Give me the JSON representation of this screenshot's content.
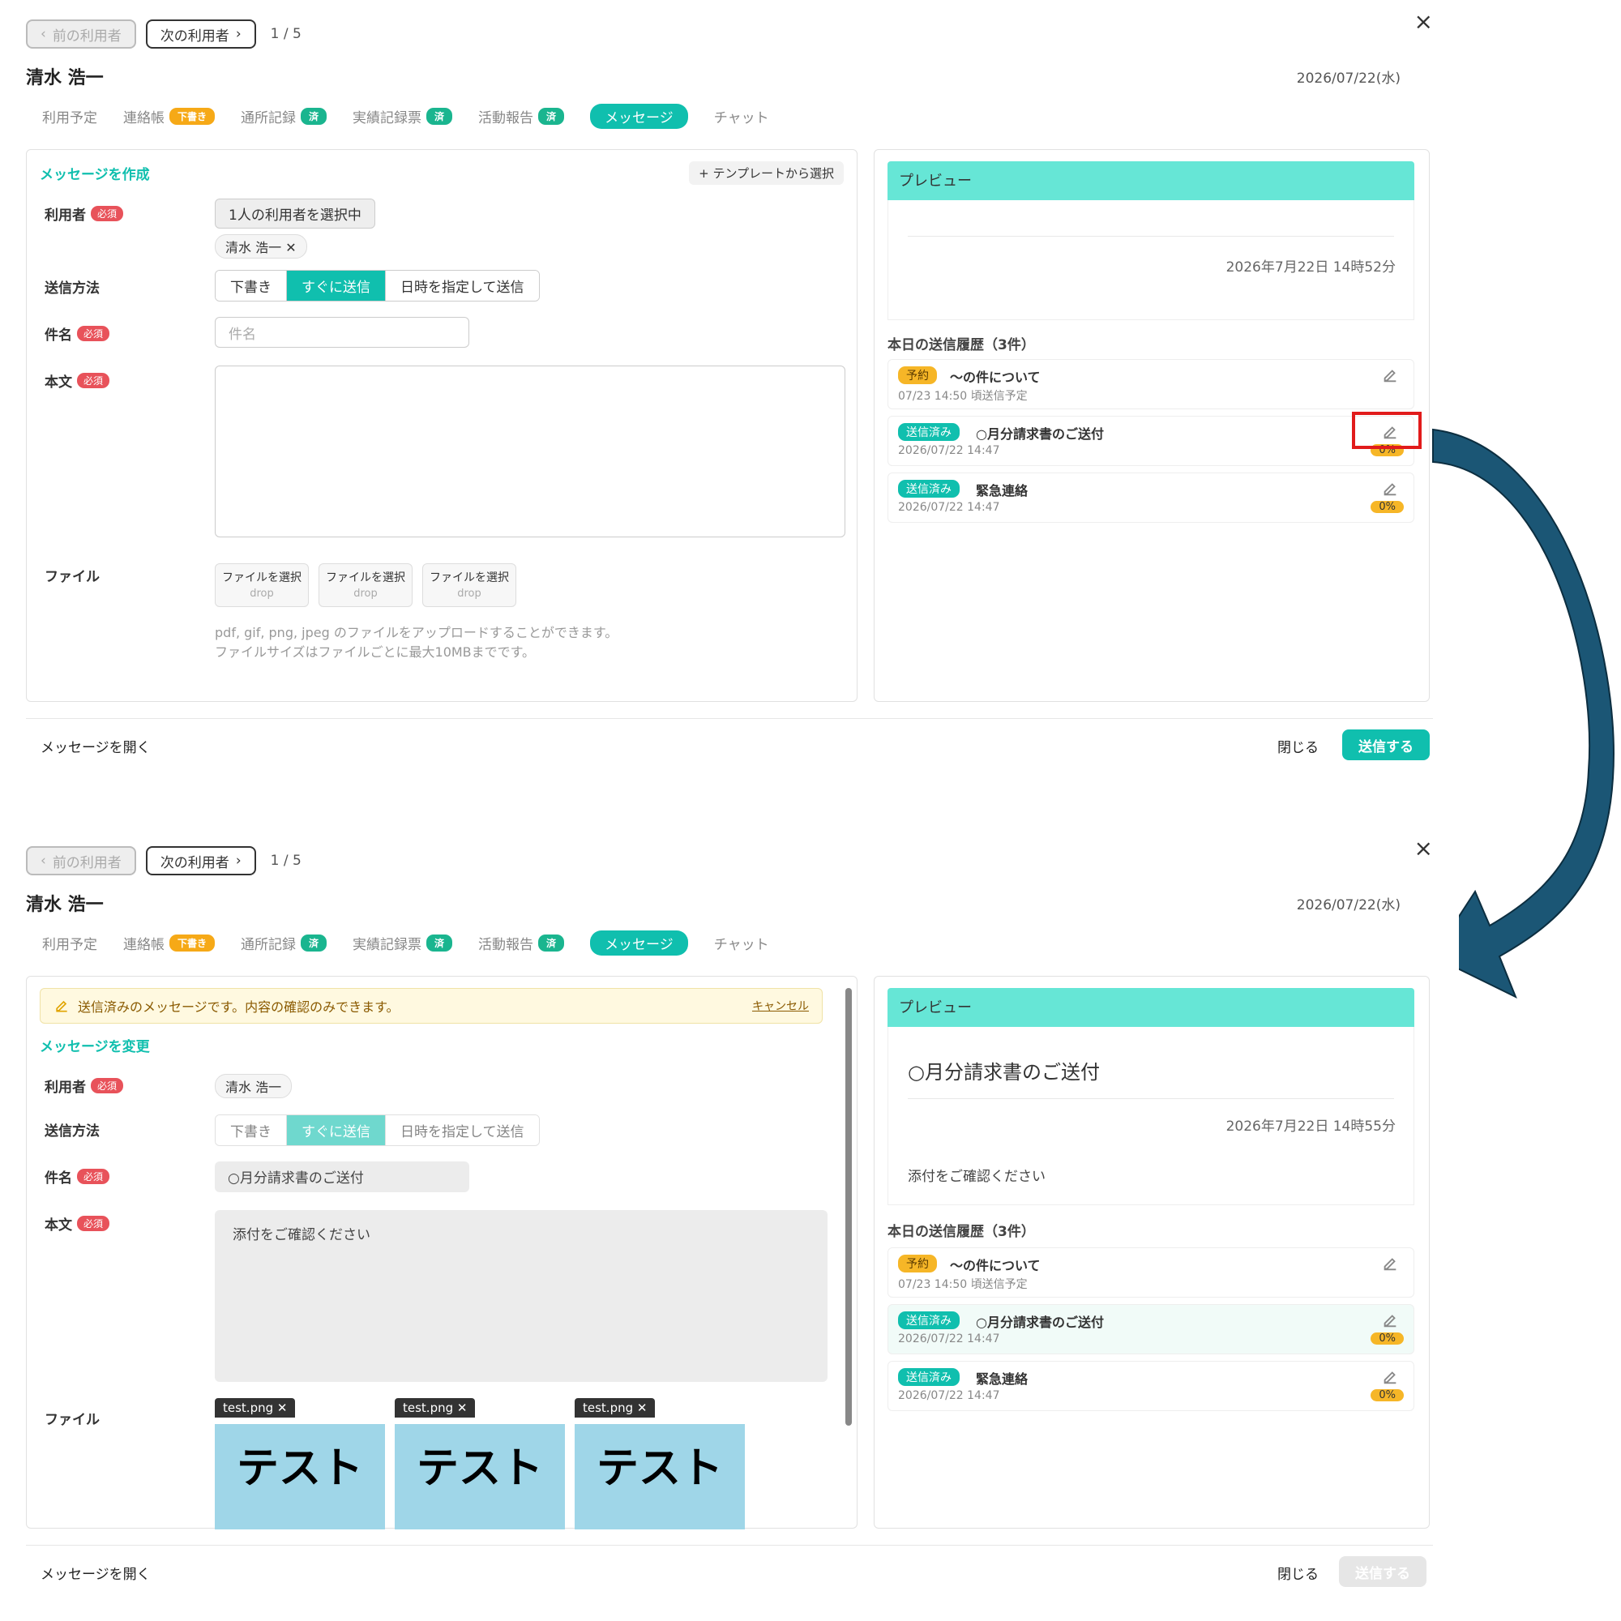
{
  "panel_a": {
    "nav": {
      "prev": "前の利用者",
      "next": "次の利用者",
      "count": "1 / 5"
    },
    "user_name": "清水 浩一",
    "date": "2026/07/22(水)",
    "tabs": [
      {
        "label": "利用予定",
        "badge": ""
      },
      {
        "label": "連絡帳",
        "badge": "下書き"
      },
      {
        "label": "通所記録",
        "badge": "済"
      },
      {
        "label": "実績記録票",
        "badge": "済"
      },
      {
        "label": "活動報告",
        "badge": "済"
      },
      {
        "label": "メッセージ",
        "badge": ""
      },
      {
        "label": "チャット",
        "badge": ""
      }
    ],
    "form": {
      "title": "メッセージを作成",
      "template_btn": "+ テンプレートから選択",
      "user_label": "利用者",
      "required": "必須",
      "user_chip": "1人の利用者を選択中",
      "user_tag": "清水 浩一",
      "method_label": "送信方法",
      "methods": [
        "下書き",
        "すぐに送信",
        "日時を指定して送信"
      ],
      "subject_label": "件名",
      "subject_placeholder": "件名",
      "body_label": "本文",
      "file_label": "ファイル",
      "file_select": "ファイルを選択",
      "file_drop": "drop",
      "note_1": "pdf, gif, png, jpeg のファイルをアップロードすることができます。",
      "note_2": "ファイルサイズはファイルごとに最大10MBまでです。"
    },
    "preview": {
      "title": "プレビュー",
      "date": "2026年7月22日 14時52分"
    },
    "history": {
      "title": "本日の送信履歴（3件）",
      "items": [
        {
          "badge": "予約",
          "title": "～の件について",
          "sub": "07/23 14:50 頃送信予定",
          "pct": ""
        },
        {
          "badge": "送信済み",
          "title": "○月分請求書のご送付",
          "sub": "2026/07/22 14:47",
          "pct": "0%"
        },
        {
          "badge": "送信済み",
          "title": "緊急連絡",
          "sub": "2026/07/22 14:47",
          "pct": "0%"
        }
      ]
    },
    "footer": {
      "open": "メッセージを開く",
      "close": "閉じる",
      "send": "送信する"
    }
  },
  "panel_b": {
    "nav": {
      "prev": "前の利用者",
      "next": "次の利用者",
      "count": "1 / 5"
    },
    "user_name": "清水 浩一",
    "date": "2026/07/22(水)",
    "tabs": [
      {
        "label": "利用予定",
        "badge": ""
      },
      {
        "label": "連絡帳",
        "badge": "下書き"
      },
      {
        "label": "通所記録",
        "badge": "済"
      },
      {
        "label": "実績記録票",
        "badge": "済"
      },
      {
        "label": "活動報告",
        "badge": "済"
      },
      {
        "label": "メッセージ",
        "badge": ""
      },
      {
        "label": "チャット",
        "badge": ""
      }
    ],
    "notice": {
      "text": "送信済みのメッセージです。内容の確認のみできます。",
      "cancel": "キャンセル"
    },
    "form": {
      "title": "メッセージを変更",
      "user_label": "利用者",
      "required": "必須",
      "user_tag": "清水 浩一",
      "method_label": "送信方法",
      "methods": [
        "下書き",
        "すぐに送信",
        "日時を指定して送信"
      ],
      "subject_label": "件名",
      "subject_value": "○月分請求書のご送付",
      "body_label": "本文",
      "body_value": "添付をご確認ください",
      "file_label": "ファイル",
      "files": [
        "test.png",
        "test.png",
        "test.png"
      ],
      "thumb_text": "テスト"
    },
    "preview": {
      "title": "プレビュー",
      "subject": "○月分請求書のご送付",
      "date": "2026年7月22日 14時55分",
      "body": "添付をご確認ください"
    },
    "history": {
      "title": "本日の送信履歴（3件）",
      "items": [
        {
          "badge": "予約",
          "title": "～の件について",
          "sub": "07/23 14:50 頃送信予定",
          "pct": ""
        },
        {
          "badge": "送信済み",
          "title": "○月分請求書のご送付",
          "sub": "2026/07/22 14:47",
          "pct": "0%"
        },
        {
          "badge": "送信済み",
          "title": "緊急連絡",
          "sub": "2026/07/22 14:47",
          "pct": "0%"
        }
      ]
    },
    "footer": {
      "open": "メッセージを開く",
      "close": "閉じる",
      "send": "送信する"
    }
  },
  "colors": {
    "accent": "#10bfae",
    "preview_header": "#66e6d6",
    "arrow": "#1b5675",
    "highlight": "#e11b1b"
  }
}
